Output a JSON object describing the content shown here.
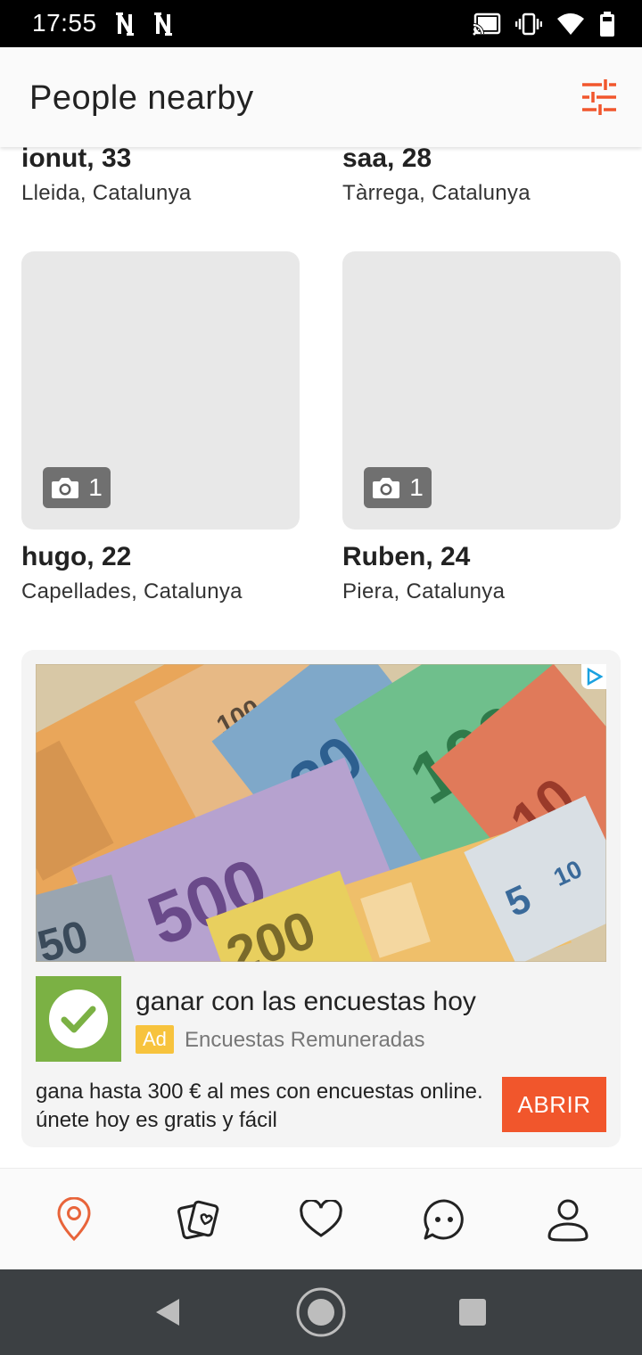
{
  "status_bar": {
    "time": "17:55"
  },
  "header": {
    "title": "People nearby"
  },
  "people": [
    {
      "name": "ionut, 33",
      "location": "Lleida, Catalunya"
    },
    {
      "name": "saa, 28",
      "location": "Tàrrega, Catalunya"
    },
    {
      "name": "hugo, 22",
      "location": "Capellades, Catalunya",
      "photo_count": "1"
    },
    {
      "name": "Ruben, 24",
      "location": "Piera, Catalunya",
      "photo_count": "1"
    }
  ],
  "ad": {
    "title": "ganar con las encuestas hoy",
    "label": "Ad",
    "advertiser": "Encuestas Remuneradas",
    "description": "gana hasta 300 € al mes con encuestas online. únete hoy es gratis y fácil",
    "cta": "ABRIR",
    "banknote_numbers": [
      "100",
      "20",
      "100",
      "10",
      "500",
      "50",
      "5",
      "10",
      "200"
    ]
  },
  "colors": {
    "accent": "#f1562c",
    "nav_active": "#e8643a",
    "ad_badge": "#f7c33d",
    "ad_logo": "#7bb144"
  },
  "bottom_nav": [
    "location-pin-icon",
    "cards-icon",
    "heart-icon",
    "chat-bubble-icon",
    "profile-icon"
  ]
}
